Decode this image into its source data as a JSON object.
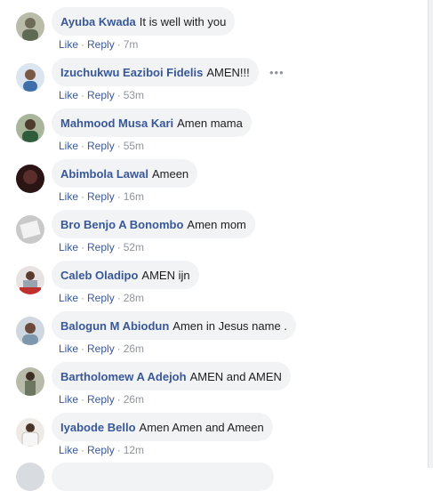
{
  "actions": {
    "like": "Like",
    "reply": "Reply",
    "separator": "·"
  },
  "more_icon": "more-horizontal-icon",
  "comments": [
    {
      "author": "Ayuba Kwada",
      "text": "It is well with you",
      "time": "7m",
      "avatar_color": "#8a8f7a"
    },
    {
      "author": "Izuchukwu Eaziboi Fidelis",
      "text": "AMEN!!!",
      "time": "53m",
      "avatar_color": "#b7c3d3"
    },
    {
      "author": "Mahmood Musa Kari",
      "text": "Amen mama",
      "time": "55m",
      "avatar_color": "#6f8a63"
    },
    {
      "author": "Abimbola Lawal",
      "text": "Ameen",
      "time": "16m",
      "avatar_color": "#3a1a1a"
    },
    {
      "author": "Bro Benjo A Bonombo",
      "text": "Amen mom",
      "time": "52m",
      "avatar_color": "#9a9a9a"
    },
    {
      "author": "Caleb Oladipo",
      "text": "AMEN ijn",
      "time": "28m",
      "avatar_color": "#c84a4a"
    },
    {
      "author": "Balogun M Abiodun",
      "text": "Amen in Jesus name .",
      "time": "26m",
      "avatar_color": "#8c9aa6"
    },
    {
      "author": "Bartholomew A Adejoh",
      "text": "AMEN and AMEN",
      "time": "26m",
      "avatar_color": "#7d8471"
    },
    {
      "author": "Iyabode Bello",
      "text": "Amen Amen and Ameen",
      "time": "12m",
      "avatar_color": "#d9d2cc"
    }
  ]
}
